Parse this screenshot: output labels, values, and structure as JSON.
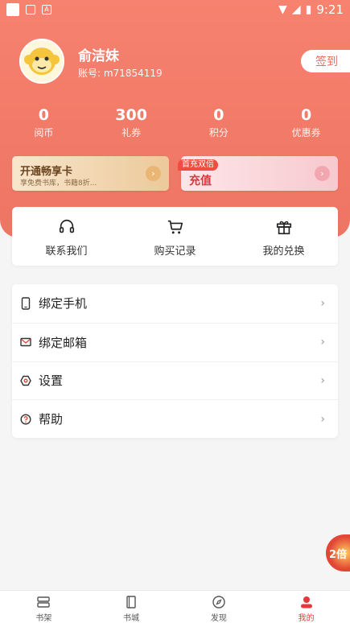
{
  "status_bar": {
    "time": "9:21"
  },
  "profile": {
    "username": "俞洁妹",
    "account": "账号: m71854119",
    "signin_label": "签到"
  },
  "stats": [
    {
      "value": "0",
      "label": "阅币"
    },
    {
      "value": "300",
      "label": "礼券"
    },
    {
      "value": "0",
      "label": "积分"
    },
    {
      "value": "0",
      "label": "优惠券"
    }
  ],
  "promo_cards": {
    "vip": {
      "title": "开通畅享卡",
      "subtitle": "享免费书库，书籍8折..."
    },
    "recharge": {
      "tag": "首充双倍",
      "title": "充值"
    }
  },
  "quick_actions": [
    {
      "label": "联系我们",
      "icon": "headset-icon"
    },
    {
      "label": "购买记录",
      "icon": "cart-icon"
    },
    {
      "label": "我的兑换",
      "icon": "gift-icon"
    }
  ],
  "menu": [
    {
      "label": "绑定手机",
      "icon": "phone-icon"
    },
    {
      "label": "绑定邮箱",
      "icon": "mail-icon"
    },
    {
      "label": "设置",
      "icon": "settings-icon"
    },
    {
      "label": "帮助",
      "icon": "help-icon"
    }
  ],
  "floating_promo": {
    "label": "2倍"
  },
  "tabs": [
    {
      "label": "书架",
      "icon": "bookshelf-icon",
      "active": false
    },
    {
      "label": "书城",
      "icon": "book-icon",
      "active": false
    },
    {
      "label": "发现",
      "icon": "compass-icon",
      "active": false
    },
    {
      "label": "我的",
      "icon": "user-icon",
      "active": true
    }
  ],
  "colors": {
    "accent": "#f27a68",
    "active_tab": "#e53a3a"
  }
}
